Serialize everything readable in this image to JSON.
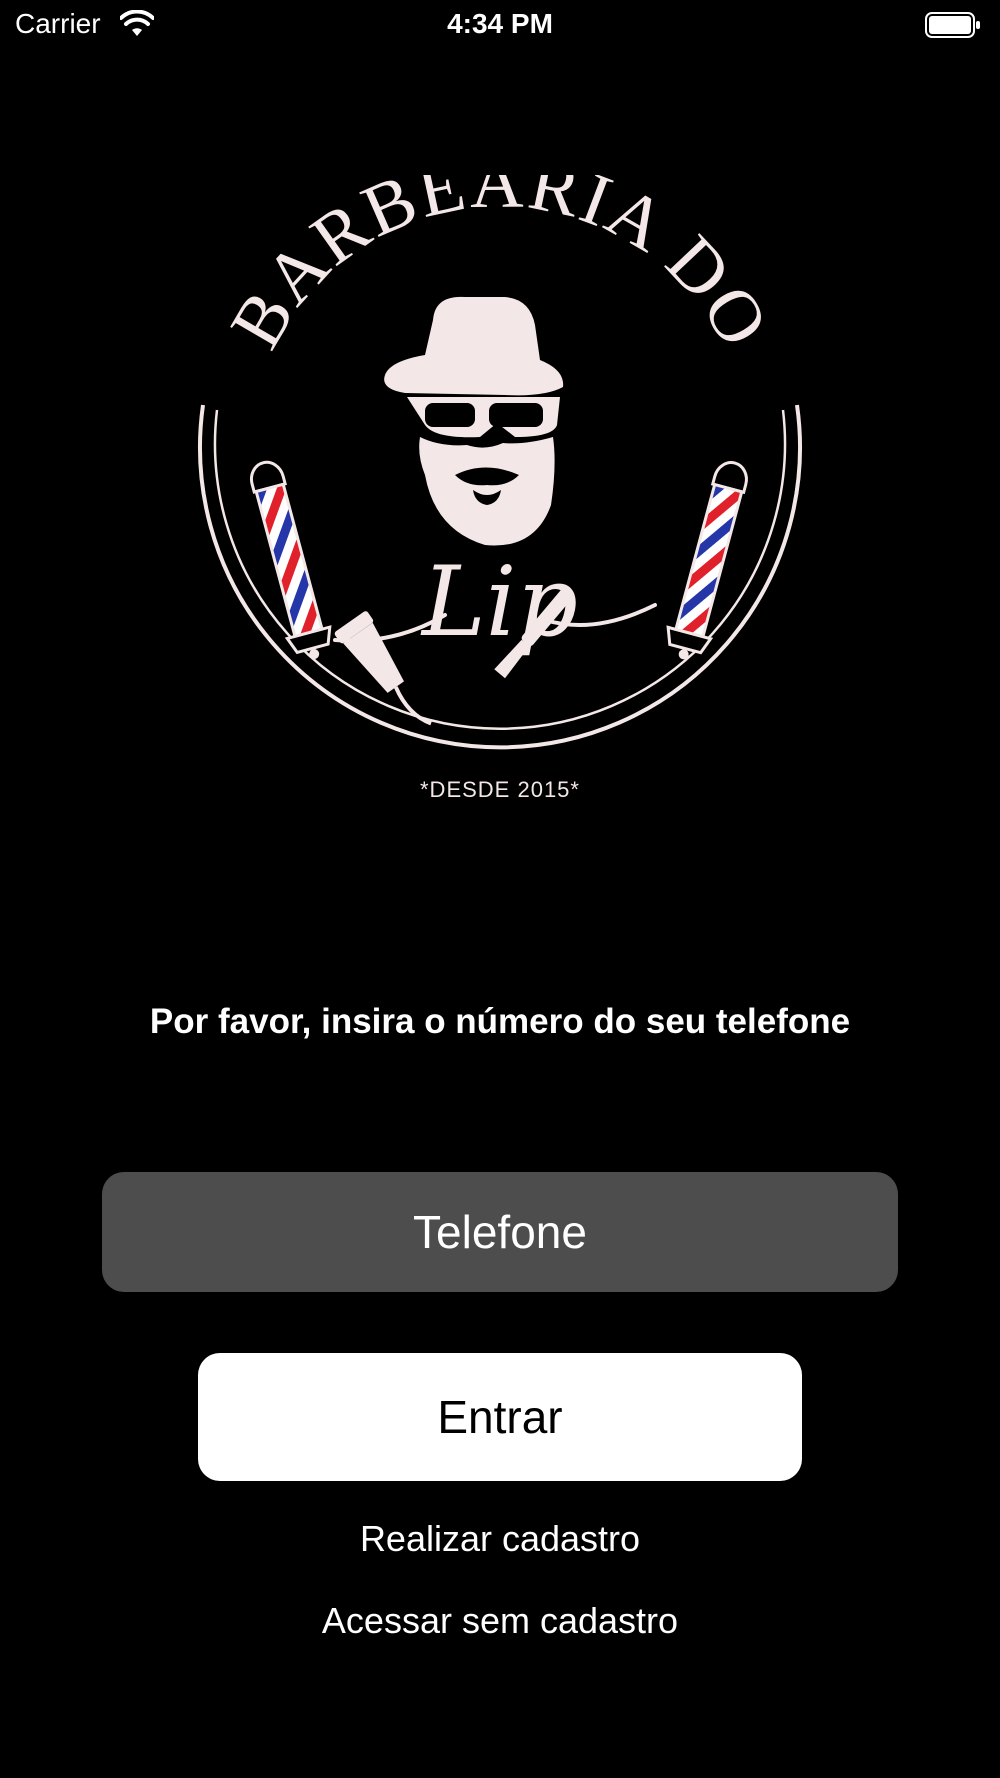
{
  "status_bar": {
    "carrier": "Carrier",
    "time": "4:34 PM",
    "icons": [
      "wifi-icon",
      "battery-icon"
    ]
  },
  "logo": {
    "title": "BARBEARIA DO",
    "signature": "Lip",
    "since": "*DESDE 2015*",
    "colors": {
      "line": "#f3e7e7",
      "pole_red": "#e0202a",
      "pole_blue": "#2436a8"
    }
  },
  "login": {
    "prompt": "Por favor, insira o número do seu telefone",
    "phone_placeholder": "Telefone",
    "phone_value": "",
    "enter_label": "Entrar",
    "register_label": "Realizar cadastro",
    "guest_label": "Acessar sem cadastro"
  },
  "colors": {
    "background": "#000000",
    "input_background": "#4d4d4d",
    "button_background": "#ffffff",
    "button_text": "#000000",
    "text": "#ffffff"
  }
}
